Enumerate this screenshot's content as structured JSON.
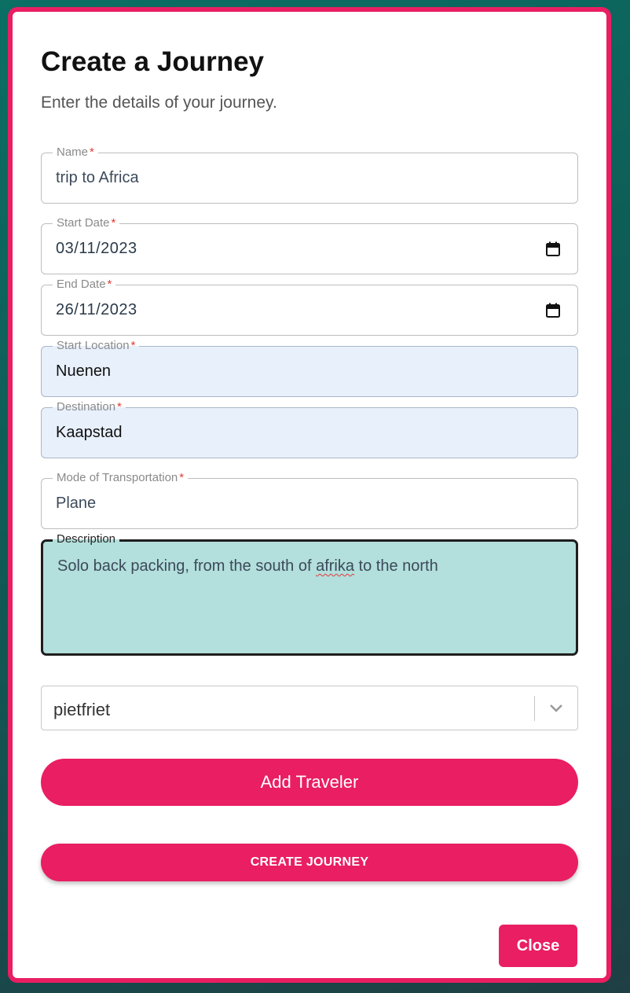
{
  "dialog": {
    "title": "Create a Journey",
    "subtitle": "Enter the details of your journey."
  },
  "fields": {
    "name": {
      "label": "Name",
      "required": "*",
      "value": "trip to Africa"
    },
    "start_date": {
      "label": "Start Date",
      "required": "*",
      "value": "03/11/2023"
    },
    "end_date": {
      "label": "End Date",
      "required": "*",
      "value": "26/11/2023"
    },
    "start_location": {
      "label": "Start Location",
      "required": "*",
      "value": "Nuenen"
    },
    "destination": {
      "label": "Destination",
      "required": "*",
      "value": "Kaapstad"
    },
    "transport": {
      "label": "Mode of Transportation",
      "required": "*",
      "value": "Plane"
    },
    "description": {
      "label": "Description",
      "value_before": "Solo back packing, from the south of ",
      "value_misspelled": "afrika",
      "value_after": " to the north"
    }
  },
  "traveler_select": {
    "selected": "pietfriet"
  },
  "buttons": {
    "add_traveler": "Add Traveler",
    "create_journey": "CREATE JOURNEY",
    "close": "Close"
  },
  "colors": {
    "accent": "#e91e63",
    "autofill": "#e8f0fc",
    "focused": "#b3dfdc"
  }
}
